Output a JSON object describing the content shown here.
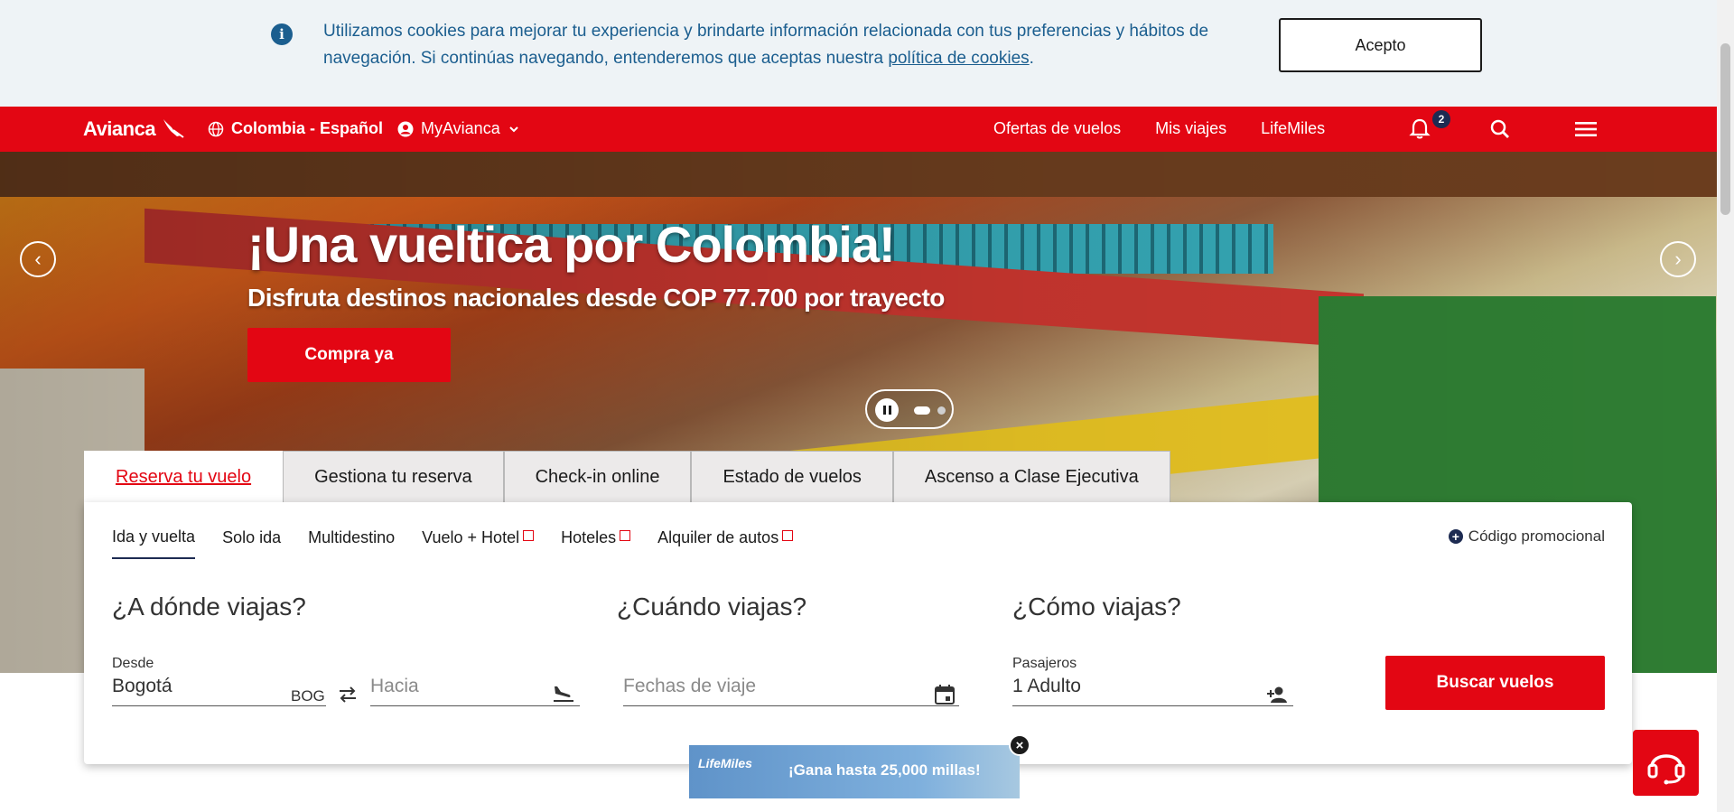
{
  "cookie": {
    "text": "Utilizamos cookies para mejorar tu experiencia y brindarte información relacionada con tus preferencias y hábitos de navegación. Si continúas navegando, entenderemos que aceptas nuestra ",
    "link": "política de cookies",
    "end": ".",
    "accept": "Acepto"
  },
  "nav": {
    "logo": "Avianca",
    "lang": "Colombia - Español",
    "account": "MyAvianca",
    "links": [
      "Ofertas de vuelos",
      "Mis viajes",
      "LifeMiles"
    ],
    "badge": "2"
  },
  "hero": {
    "title": "¡Una vueltica por Colombia!",
    "subtitle": "Disfruta destinos nacionales desde COP 77.700 por trayecto",
    "cta": "Compra ya",
    "slides": 2,
    "current_slide": 1
  },
  "tabs": [
    "Reserva tu vuelo",
    "Gestiona tu reserva",
    "Check-in online",
    "Estado de vuelos",
    "Ascenso a Clase Ejecutiva"
  ],
  "subtabs": [
    "Ida y vuelta",
    "Solo ida",
    "Multidestino",
    "Vuelo + Hotel",
    "Hoteles",
    "Alquiler de autos"
  ],
  "promo": "Código promocional",
  "form": {
    "where_title": "¿A dónde viajas?",
    "when_title": "¿Cuándo viajas?",
    "how_title": "¿Cómo viajas?",
    "from_label": "Desde",
    "from_value": "Bogotá",
    "from_code": "BOG",
    "to_placeholder": "Hacia",
    "dates_placeholder": "Fechas de viaje",
    "pax_label": "Pasajeros",
    "pax_value": "1 Adulto",
    "search": "Buscar vuelos"
  },
  "lifemiles_banner": {
    "brand": "LifeMiles",
    "text": "¡Gana hasta 25,000 millas!"
  },
  "colors": {
    "brand_red": "#e30613",
    "navy": "#1d2b52",
    "cookie_text": "#1b5e8f"
  }
}
